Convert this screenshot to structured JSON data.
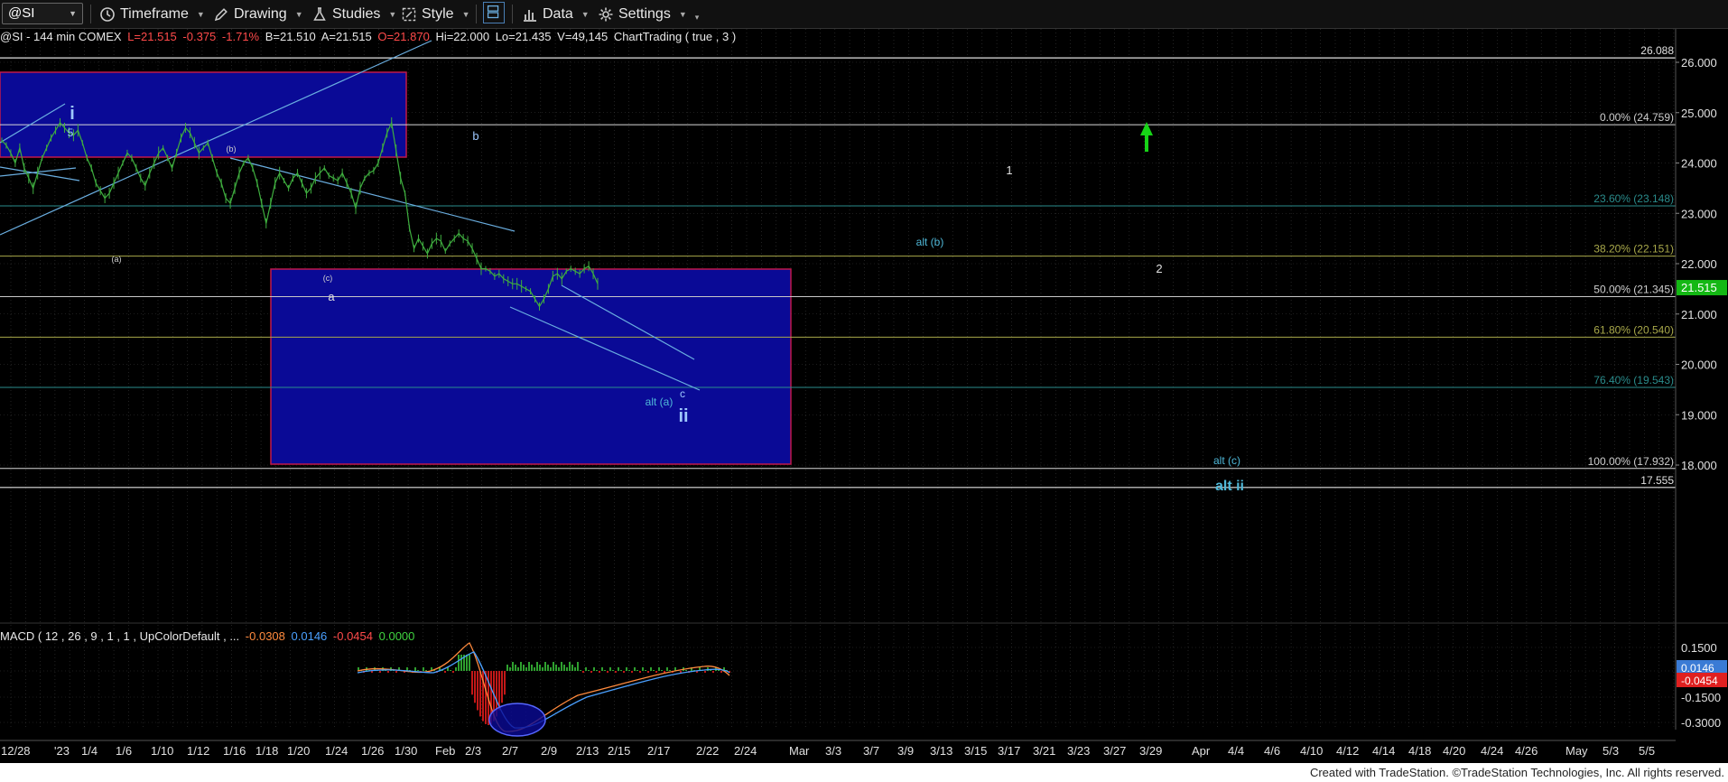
{
  "toolbar": {
    "symbol": "@SI",
    "timeframe": "Timeframe",
    "drawing": "Drawing",
    "studies": "Studies",
    "style": "Style",
    "data": "Data",
    "settings": "Settings"
  },
  "header": {
    "title": "@SI - 144 min  COMEX",
    "last": "L=21.515",
    "chg": "-0.375",
    "pct": "-1.71%",
    "bid": "B=21.510",
    "ask": "A=21.515",
    "open": "O=21.870",
    "hi": "Hi=22.000",
    "lo": "Lo=21.435",
    "vol": "V=49,145",
    "study": "ChartTrading ( true , 3 )"
  },
  "macd_legend": {
    "label": "MACD ( 12 , 26 , 9 , 1 , 1 , UpColorDefault , ...",
    "v1": "-0.0308",
    "v2": "0.0146",
    "v3": "-0.0454",
    "v4": "0.0000"
  },
  "footer": "Created with TradeStation. ©TradeStation Technologies, Inc. All rights reserved.",
  "colors": {
    "price": "#3fae3f",
    "blue_box": "#0a0a96",
    "box_border": "#c0184a",
    "trend": "#6aaee0",
    "label_cyan": "#4fb8d8",
    "up_arrow": "#17d417",
    "last_price_bg": "#14b814"
  },
  "chart_data": {
    "type": "line",
    "title": "@SI - 144 min COMEX",
    "price_axis": {
      "ticks": [
        26.0,
        25.0,
        24.0,
        23.0,
        22.0,
        21.0,
        20.0,
        19.0,
        18.0
      ],
      "tick_labels": [
        "26.000",
        "25.000",
        "24.000",
        "23.000",
        "22.000",
        "21.000",
        "20.000",
        "19.000",
        "18.000"
      ],
      "ylim": [
        17.3,
        26.6
      ],
      "last_price": 21.515,
      "last_price_label": "21.515"
    },
    "time_axis": {
      "labels": [
        "12/28",
        "'23",
        "1/4",
        "1/6",
        "1/10",
        "1/12",
        "1/16",
        "1/18",
        "1/20",
        "1/24",
        "1/26",
        "1/30",
        "Feb",
        "2/3",
        "2/7",
        "2/9",
        "2/13",
        "2/15",
        "2/17",
        "2/22",
        "2/24",
        "Mar",
        "3/3",
        "3/7",
        "3/9",
        "3/13",
        "3/15",
        "3/17",
        "3/21",
        "3/23",
        "3/27",
        "3/29",
        "Apr",
        "4/4",
        "4/6",
        "4/10",
        "4/12",
        "4/14",
        "4/18",
        "4/20",
        "4/24",
        "4/26",
        "May",
        "5/3",
        "5/5"
      ]
    },
    "series": [
      {
        "x": [
          0,
          5,
          10,
          15,
          20,
          25,
          30,
          35,
          40,
          45,
          50,
          55,
          60,
          65,
          70,
          75,
          80,
          85,
          90,
          95,
          100,
          105,
          110,
          115,
          120,
          125,
          130,
          135,
          140,
          145,
          150,
          155,
          160,
          165,
          170,
          175,
          180,
          185,
          190,
          195,
          200,
          205,
          210,
          215,
          220,
          225,
          230,
          235,
          240,
          245,
          250,
          255,
          260,
          265,
          270,
          275,
          280,
          285,
          290,
          295,
          300,
          305,
          310,
          315,
          320,
          325,
          330,
          335,
          340,
          345,
          350,
          355,
          360,
          365,
          370,
          375,
          380,
          385,
          390,
          395,
          400,
          405,
          410,
          415,
          420,
          425,
          430,
          435,
          440,
          445,
          450,
          455,
          460,
          465,
          470,
          475,
          480,
          485,
          490,
          495,
          500,
          505,
          510,
          515,
          520,
          525,
          530,
          535,
          540,
          545,
          550,
          555,
          560,
          565,
          570,
          575,
          580,
          585,
          590,
          595,
          600,
          605,
          610,
          615,
          620,
          625,
          630,
          635,
          640,
          645,
          650,
          655,
          660,
          665
        ],
        "values": [
          24.45,
          24.35,
          24.2,
          24.0,
          24.3,
          23.9,
          23.7,
          23.5,
          23.8,
          24.1,
          24.3,
          24.5,
          24.65,
          24.8,
          24.7,
          24.6,
          24.55,
          24.65,
          24.4,
          24.1,
          23.9,
          23.6,
          23.45,
          23.3,
          23.4,
          23.6,
          23.8,
          24.0,
          24.2,
          24.1,
          23.9,
          23.7,
          23.55,
          23.8,
          24.0,
          24.2,
          24.3,
          24.1,
          23.9,
          24.2,
          24.5,
          24.7,
          24.6,
          24.4,
          24.2,
          24.3,
          24.4,
          24.1,
          23.8,
          23.6,
          23.3,
          23.2,
          23.5,
          23.8,
          24.0,
          24.1,
          23.9,
          23.6,
          23.2,
          22.8,
          23.2,
          23.6,
          23.8,
          23.65,
          23.5,
          23.7,
          23.8,
          23.6,
          23.4,
          23.5,
          23.7,
          23.8,
          23.9,
          23.75,
          23.7,
          23.65,
          23.8,
          23.6,
          23.4,
          23.1,
          23.5,
          23.7,
          23.8,
          23.85,
          24.0,
          24.3,
          24.6,
          24.8,
          24.25,
          23.7,
          23.4,
          22.7,
          22.3,
          22.5,
          22.35,
          22.2,
          22.4,
          22.5,
          22.45,
          22.25,
          22.4,
          22.5,
          22.6,
          22.5,
          22.45,
          22.3,
          22.1,
          21.9,
          21.9,
          21.85,
          21.75,
          21.8,
          21.7,
          21.65,
          21.6,
          21.6,
          21.55,
          21.5,
          21.45,
          21.3,
          21.15,
          21.3,
          21.5,
          21.75,
          21.8,
          21.7,
          21.85,
          21.9,
          21.85,
          21.8,
          21.9,
          21.95,
          21.8,
          21.6
        ]
      }
    ],
    "macd_axis": {
      "tick_labels": [
        "0.1500",
        "0.0000",
        "-0.1500",
        "-0.3000"
      ],
      "current_labels": [
        "0.0146",
        "-0.0454"
      ]
    },
    "fib_levels": [
      {
        "price": 24.759,
        "label": "0.00% (24.759)",
        "color": "#d8d8d8"
      },
      {
        "price": 23.148,
        "label": "23.60% (23.148)",
        "color": "#2a8c8c"
      },
      {
        "price": 22.151,
        "label": "38.20% (22.151)",
        "color": "#a8a84a"
      },
      {
        "price": 21.345,
        "label": "50.00% (21.345)",
        "color": "#c8c8c8"
      },
      {
        "price": 20.54,
        "label": "61.80% (20.540)",
        "color": "#a8a84a"
      },
      {
        "price": 19.543,
        "label": "76.40% (19.543)",
        "color": "#2a8c8c"
      },
      {
        "price": 17.932,
        "label": "100.00% (17.932)",
        "color": "#d8d8d8"
      }
    ],
    "price_lines": [
      {
        "price": 26.088,
        "label": "26.088"
      },
      {
        "price": 17.555,
        "label": "17.555"
      }
    ],
    "wave_labels": [
      {
        "text": "i",
        "size": "large"
      },
      {
        "text": "5",
        "size": "small"
      },
      {
        "text": "(b)",
        "size": "tiny"
      },
      {
        "text": "(a)",
        "size": "tiny"
      },
      {
        "text": "(c)",
        "size": "tiny"
      },
      {
        "text": "a",
        "size": "small"
      },
      {
        "text": "b",
        "size": "small"
      },
      {
        "text": "c",
        "size": "small"
      },
      {
        "text": "alt (a)",
        "size": "small"
      },
      {
        "text": "ii",
        "size": "large"
      },
      {
        "text": "1",
        "size": "small"
      },
      {
        "text": "2",
        "size": "small"
      },
      {
        "text": "alt (b)",
        "size": "small"
      },
      {
        "text": "alt (c)",
        "size": "small"
      },
      {
        "text": "alt ii",
        "size": "large"
      }
    ]
  }
}
